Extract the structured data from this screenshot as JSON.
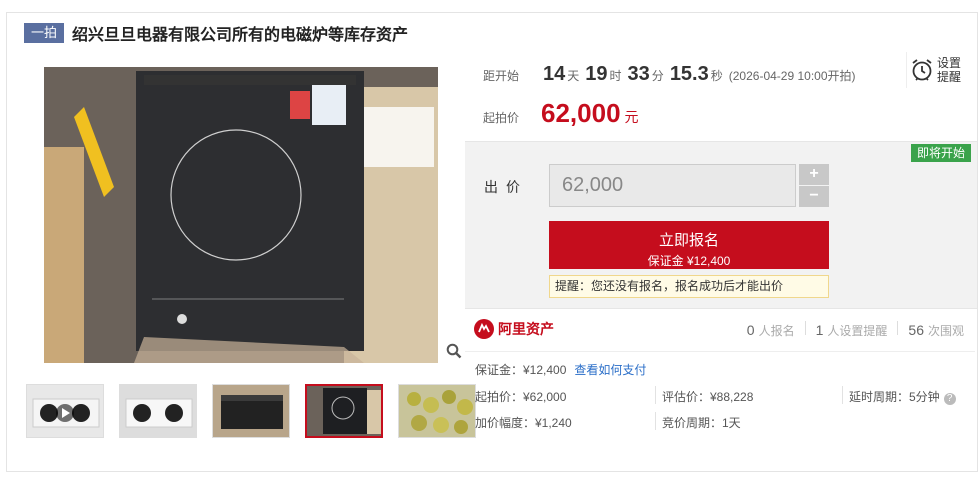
{
  "title": {
    "type_badge": "一拍",
    "text": "绍兴旦旦电器有限公司所有的电磁炉等库存资产"
  },
  "countdown": {
    "label": "距开始",
    "days": "14",
    "days_unit": "天",
    "hours": "19",
    "hours_unit": "时",
    "minutes": "33",
    "minutes_unit": "分",
    "seconds": "15.3",
    "seconds_unit": "秒",
    "start_time": "(2026-04-29 10:00开拍)"
  },
  "reminder": {
    "label": "设置提醒",
    "icon": "alarm-clock-icon"
  },
  "starting_price": {
    "label": "起拍价",
    "value": "62,000",
    "unit": "元"
  },
  "bid": {
    "status_badge": "即将开始",
    "label": "出价",
    "input_value": "62,000",
    "plus": "+",
    "minus": "−",
    "button_title": "立即报名",
    "button_sub": "保证金 ¥12,400",
    "tip": "提醒：您还没有报名，报名成功后才能出价"
  },
  "platform": {
    "name": "阿里资产",
    "logo_icon": "ali-assets-logo-icon"
  },
  "stats": {
    "signups": "0",
    "signups_label": "人报名",
    "reminders": "1",
    "reminders_label": "人设置提醒",
    "views": "56",
    "views_label": "次围观"
  },
  "details": {
    "deposit": "保证金：¥12,400",
    "deposit_link": "查看如何支付",
    "start_price": "起拍价：¥62,000",
    "valuation": "评估价：¥88,228",
    "delay": "延时周期：5分钟",
    "increment": "加价幅度：¥1,240",
    "cycle": "竞价周期：1天"
  },
  "colors": {
    "accent": "#c50d1d",
    "badge_green": "#3aa34b",
    "type_badge": "#5a6fa0",
    "link": "#2a6ec8"
  }
}
